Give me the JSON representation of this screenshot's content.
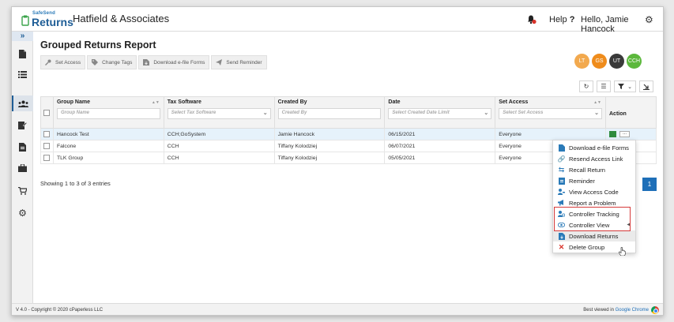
{
  "header": {
    "logo_small": "SafeSend",
    "logo_big": "Returns",
    "firm_name": "Hatfield & Associates",
    "help_label": "Help",
    "help_symbol": "?",
    "greeting": "Hello, Jamie Hancock"
  },
  "page": {
    "title": "Grouped Returns Report"
  },
  "toolbar": {
    "set_access": "Set Access",
    "change_tags": "Change Tags",
    "download_efile": "Download e-file Forms",
    "send_reminder": "Send Reminder"
  },
  "avatars": [
    {
      "initials": "LT",
      "color": "#f2a94e"
    },
    {
      "initials": "GS",
      "color": "#ef8c1c"
    },
    {
      "initials": "UT",
      "color": "#3a3a3a"
    },
    {
      "initials": "CCH",
      "color": "#5cb83c"
    }
  ],
  "table": {
    "columns": [
      {
        "label": "Group Name",
        "placeholder": "Group Name"
      },
      {
        "label": "Tax Software",
        "placeholder": "Select Tax Software"
      },
      {
        "label": "Created By",
        "placeholder": "Created By"
      },
      {
        "label": "Date",
        "placeholder": "Select Created Date Limit"
      },
      {
        "label": "Set Access",
        "placeholder": "Select Set Access"
      },
      {
        "label": "Action"
      }
    ],
    "rows": [
      {
        "group": "Hancock Test",
        "software": "CCH;GoSystem",
        "created_by": "Jamie Hancock",
        "date": "06/15/2021",
        "access": "Everyone"
      },
      {
        "group": "Falcone",
        "software": "CCH",
        "created_by": "Tiffany Kolodziej",
        "date": "06/07/2021",
        "access": "Everyone"
      },
      {
        "group": "TLK Group",
        "software": "CCH",
        "created_by": "Tiffany Kolodziej",
        "date": "05/05/2021",
        "access": "Everyone"
      }
    ],
    "action_more": "..."
  },
  "pagination": {
    "showing": "Showing 1 to 3 of 3 entries",
    "current_page": "1"
  },
  "menu": {
    "items": [
      "Download e-file Forms",
      "Resend Access Link",
      "Recall Return",
      "Reminder",
      "View Access Code",
      "Report a Problem",
      "Controller Tracking",
      "Controller View",
      "Download Returns",
      "Delete Group"
    ]
  },
  "footer": {
    "copyright": "V 4.0 - Copyright © 2020 cPaperless LLC",
    "best_viewed": "Best viewed in",
    "browser": "Google Chrome"
  },
  "colors": {
    "primary": "#1e6fb8",
    "highlight_row": "#e6f2fb",
    "annotation_red": "#d63a3a"
  }
}
